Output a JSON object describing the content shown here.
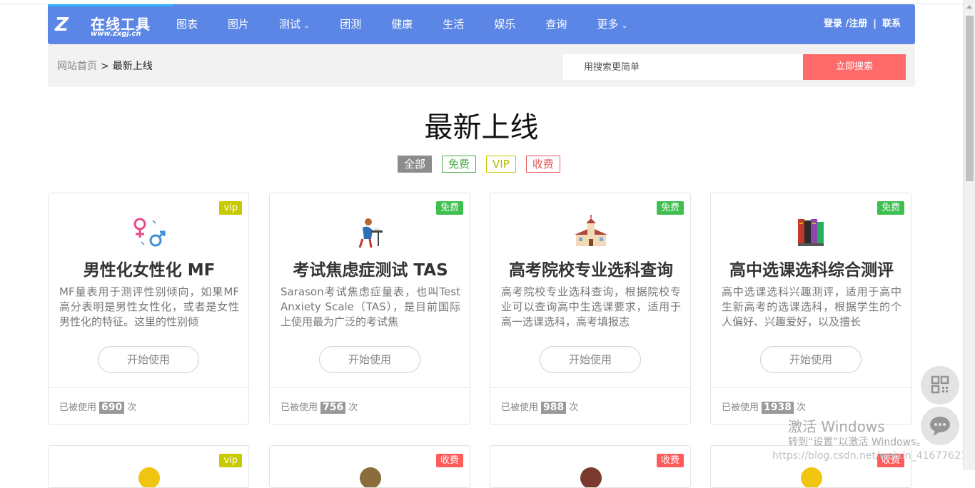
{
  "nav": {
    "logo_name": "在线工具",
    "logo_url": "www.zxgj.cn",
    "items": [
      {
        "label": "图表",
        "dropdown": false
      },
      {
        "label": "图片",
        "dropdown": false
      },
      {
        "label": "测试",
        "dropdown": true
      },
      {
        "label": "团测",
        "dropdown": false
      },
      {
        "label": "健康",
        "dropdown": false
      },
      {
        "label": "生活",
        "dropdown": false
      },
      {
        "label": "娱乐",
        "dropdown": false
      },
      {
        "label": "查询",
        "dropdown": false
      },
      {
        "label": "更多",
        "dropdown": true
      }
    ],
    "login": "登录 /注册",
    "divider": "|",
    "contact": "联系",
    "color": "#5b86e5"
  },
  "breadcrumb": {
    "home": "网站首页",
    "separator": ">",
    "current": "最新上线"
  },
  "search": {
    "placeholder": "用搜索更简单",
    "button": "立即搜索"
  },
  "page_title": "最新上线",
  "filters": {
    "all": "全部",
    "free": "免费",
    "vip": "VIP",
    "paid": "收费"
  },
  "cards": [
    {
      "badge": "vip",
      "badge_type": "vip",
      "icon": "gender-symbols-icon",
      "title": "男性化女性化 MF",
      "desc": "MF量表用于测评性别倾向，如果MF高分表明是男性女性化，或者是女性男性化的特征。这里的性别倾",
      "start": "开始使用",
      "usage_prefix": "已被使用",
      "count": "690",
      "usage_suffix": "次"
    },
    {
      "badge": "免费",
      "badge_type": "free",
      "icon": "student-at-desk-icon",
      "title": "考试焦虑症测试 TAS",
      "desc": "Sarason考试焦虑症量表，也叫Test Anxiety Scale（TAS），是目前国际上使用最为广泛的考试焦",
      "start": "开始使用",
      "usage_prefix": "已被使用",
      "count": "756",
      "usage_suffix": "次"
    },
    {
      "badge": "免费",
      "badge_type": "free",
      "icon": "school-building-icon",
      "title": "高考院校专业选科查询",
      "desc": "高考院校专业选科查询，根据院校专业可以查询高中生选课要求，适用于高一选课选科，高考填报志",
      "start": "开始使用",
      "usage_prefix": "已被使用",
      "count": "988",
      "usage_suffix": "次"
    },
    {
      "badge": "免费",
      "badge_type": "free",
      "icon": "books-icon",
      "title": "高中选课选科综合测评",
      "desc": "高中选课选科兴趣测评，适用于高中生新高考的选课选科，根据学生的个人偏好、兴趣爱好，以及擅长",
      "start": "开始使用",
      "usage_prefix": "已被使用",
      "count": "1938",
      "usage_suffix": "次"
    }
  ],
  "cards_row2": [
    {
      "badge": "vip",
      "badge_type": "vip"
    },
    {
      "badge": "收费",
      "badge_type": "paid"
    },
    {
      "badge": "收费",
      "badge_type": "paid"
    },
    {
      "badge": "收费",
      "badge_type": "paid"
    }
  ],
  "watermark": {
    "line1": "激活 Windows",
    "line2": "转到“设置”以激活 Windows。",
    "line3": "https://blog.csdn.net/weixin_41677621"
  }
}
